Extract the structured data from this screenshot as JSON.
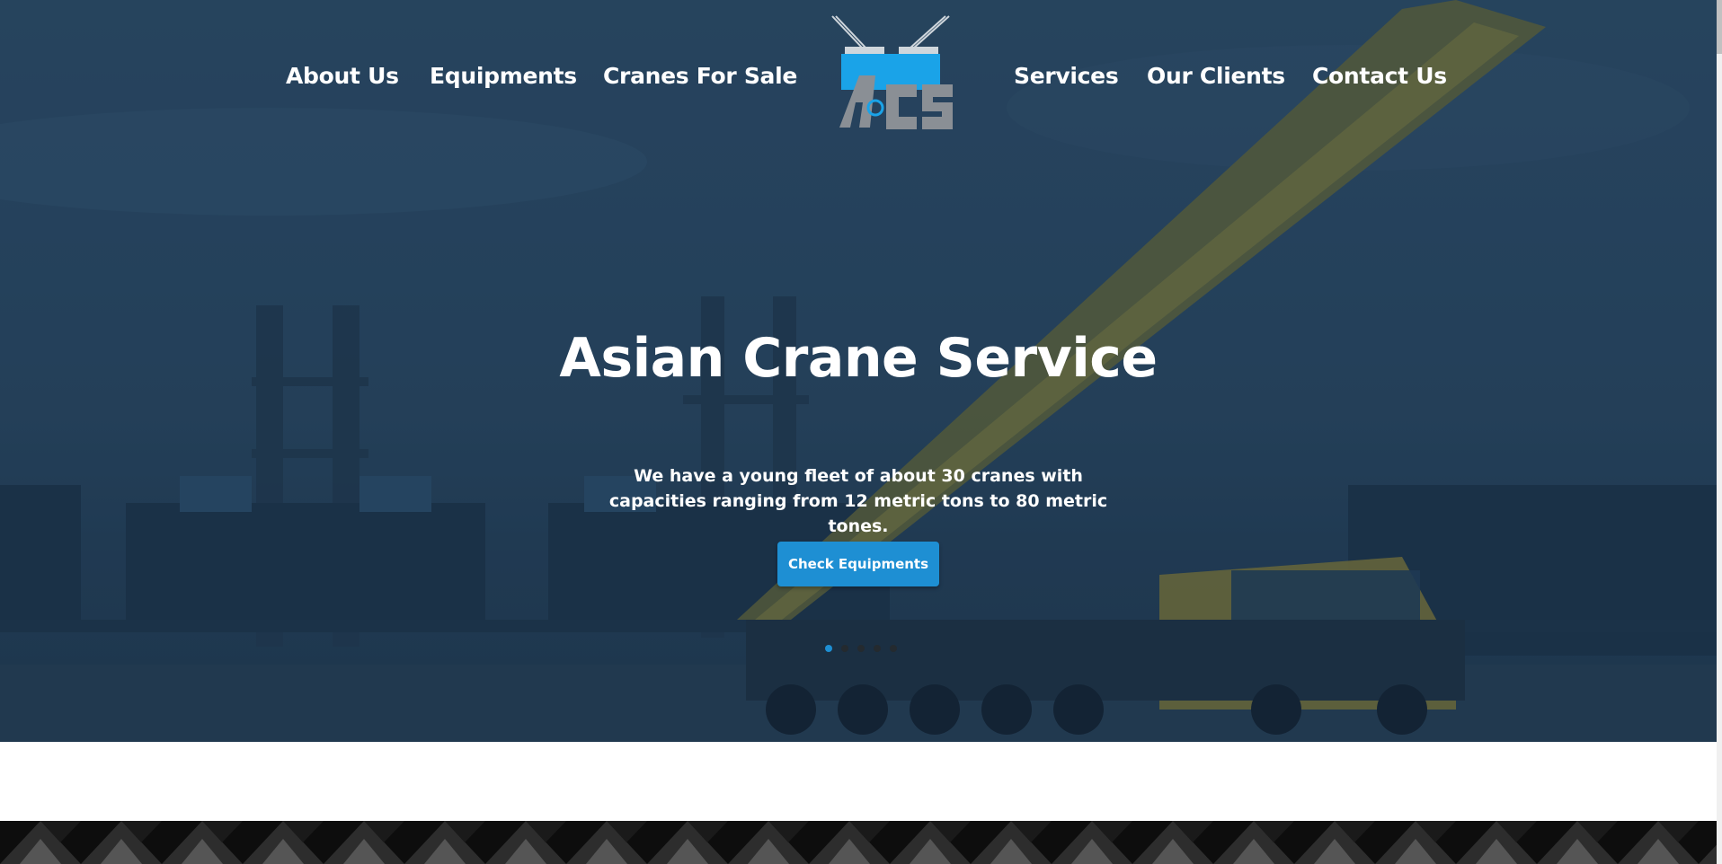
{
  "nav": {
    "left": [
      "About Us",
      "Equipments",
      "Cranes For Sale"
    ],
    "right": [
      "Services",
      "Our Clients",
      "Contact Us"
    ]
  },
  "logo": {
    "icon": "crane-logo-icon"
  },
  "hero": {
    "title": "Asian Crane Service",
    "subtitle": "We have a young fleet of about 30 cranes with capacities ranging from 12 metric tons to 80 metric tones.",
    "cta_label": "Check Equipments",
    "slides": 5,
    "active_slide": 1
  },
  "colors": {
    "accent": "#1e8fd3",
    "hero_overlay": "#28435a",
    "crane_yellow": "#c9b23a"
  }
}
